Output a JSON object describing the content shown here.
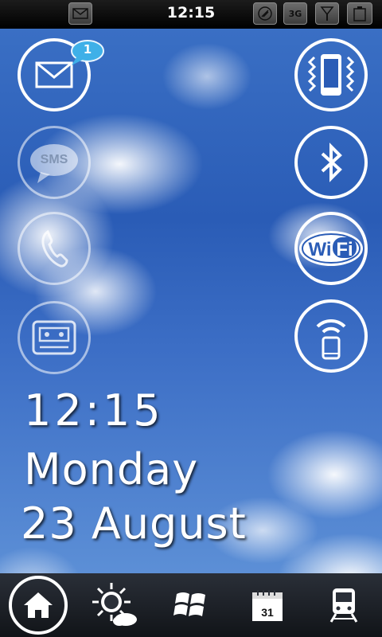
{
  "status_bar": {
    "time": "12:15",
    "network_label": "3G",
    "icons": [
      "message-icon",
      "sync-icon",
      "3g-icon",
      "signal-icon",
      "battery-icon"
    ]
  },
  "left_buttons": [
    {
      "name": "email-icon",
      "badge": "1"
    },
    {
      "name": "sms-icon",
      "label": "SMS"
    },
    {
      "name": "phone-icon"
    },
    {
      "name": "voicemail-icon"
    }
  ],
  "right_buttons": [
    {
      "name": "vibrate-icon"
    },
    {
      "name": "bluetooth-icon"
    },
    {
      "name": "wifi-icon",
      "label_wi": "Wi",
      "label_fi": "Fi"
    },
    {
      "name": "hotspot-icon"
    }
  ],
  "clock": {
    "time": "12:15",
    "day": "Monday",
    "date": "23 August"
  },
  "dock": {
    "items": [
      "home-icon",
      "weather-icon",
      "windows-icon",
      "calendar-icon",
      "train-icon"
    ],
    "calendar_day": "31"
  },
  "colors": {
    "badge": "#3fb0e8",
    "sky_top": "#2a5cb6",
    "sky_bottom": "#5c8fd6"
  }
}
